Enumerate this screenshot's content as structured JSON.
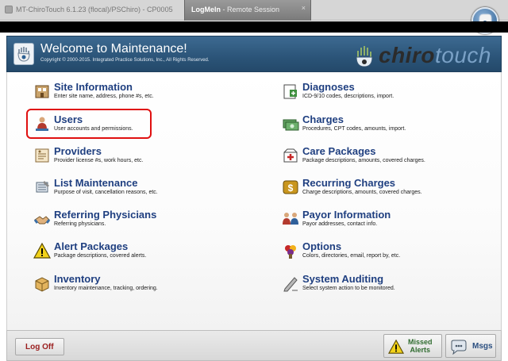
{
  "window": {
    "app_title": "MT-ChiroTouch 6.1.23 (flocal)/PSChiro) - CP0005",
    "logmein_title": "LogMeIn",
    "logmein_subtitle": " - Remote Session",
    "close_glyph": "×"
  },
  "header": {
    "welcome": "Welcome to Maintenance!",
    "copyright": "Copyright © 2000-2015. Integrated Practice Solutions, Inc., All Rights Reserved.",
    "brand_part1": "chiro",
    "brand_part2": "touch"
  },
  "left_items": [
    {
      "title": "Site Information",
      "desc": "Enter site name, address, phone #s, etc.",
      "icon": "site-info-icon"
    },
    {
      "title": "Users",
      "desc": "User accounts and permissions.",
      "icon": "users-icon"
    },
    {
      "title": "Providers",
      "desc": "Provider license #s, work hours, etc.",
      "icon": "providers-icon"
    },
    {
      "title": "List Maintenance",
      "desc": "Purpose of visit, cancellation reasons, etc.",
      "icon": "list-maintenance-icon"
    },
    {
      "title": "Referring Physicians",
      "desc": "Referring physicians.",
      "icon": "handshake-icon"
    },
    {
      "title": "Alert Packages",
      "desc": "Package descriptions, covered alerts.",
      "icon": "warning-icon"
    },
    {
      "title": "Inventory",
      "desc": "Inventory maintenance, tracking, ordering.",
      "icon": "inventory-box-icon"
    }
  ],
  "right_items": [
    {
      "title": "Diagnoses",
      "desc": "ICD-9/10 codes, descriptions, import.",
      "icon": "diagnoses-icon"
    },
    {
      "title": "Charges",
      "desc": "Procedures, CPT codes, amounts, import.",
      "icon": "charges-icon"
    },
    {
      "title": "Care Packages",
      "desc": "Package descriptions, amounts, covered charges.",
      "icon": "care-packages-icon"
    },
    {
      "title": "Recurring Charges",
      "desc": "Charge descriptions, amounts, covered charges.",
      "icon": "recurring-charges-icon"
    },
    {
      "title": "Payor Information",
      "desc": "Payor addresses, contact info.",
      "icon": "payor-icon"
    },
    {
      "title": "Options",
      "desc": "Colors, directories, email, report by, etc.",
      "icon": "options-icon"
    },
    {
      "title": "System Auditing",
      "desc": "Select system action to be monitored.",
      "icon": "auditing-pen-icon"
    }
  ],
  "footer": {
    "logoff": "Log Off",
    "missed_alerts": "Missed\nAlerts",
    "msgs": "Msgs"
  },
  "colors": {
    "header_blue": "#2b5478",
    "title_text": "#1f3f80",
    "highlight": "#e01010",
    "logoff_text": "#9b1f1f"
  }
}
